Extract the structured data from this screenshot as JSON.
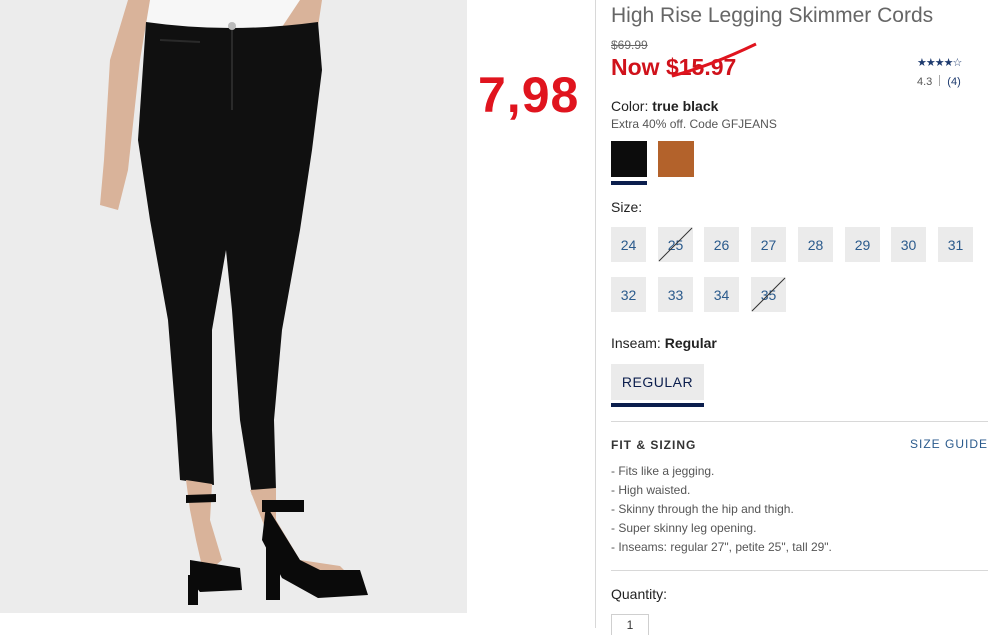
{
  "overlay": {
    "price_text": "7,98"
  },
  "product": {
    "title": "High Rise Legging Skimmer Cords",
    "original_price": "$69.99",
    "now_price": "Now $15.97",
    "rating": {
      "stars": "★★★★☆",
      "score": "4.3",
      "count": "(4)"
    }
  },
  "color": {
    "label": "Color:",
    "value": "true black",
    "promo": "Extra 40% off. Code GFJEANS",
    "swatches": [
      "#0c0c0c",
      "#b3622b"
    ]
  },
  "size": {
    "label": "Size:",
    "options": [
      {
        "label": "24",
        "available": true
      },
      {
        "label": "25",
        "available": false
      },
      {
        "label": "26",
        "available": true
      },
      {
        "label": "27",
        "available": true
      },
      {
        "label": "28",
        "available": true
      },
      {
        "label": "29",
        "available": true
      },
      {
        "label": "30",
        "available": true
      },
      {
        "label": "31",
        "available": true
      },
      {
        "label": "32",
        "available": true
      },
      {
        "label": "33",
        "available": true
      },
      {
        "label": "34",
        "available": true
      },
      {
        "label": "35",
        "available": false
      }
    ]
  },
  "inseam": {
    "label": "Inseam:",
    "value": "Regular",
    "option": "REGULAR"
  },
  "fit": {
    "title": "FIT & SIZING",
    "size_guide": "SIZE GUIDE",
    "items": [
      "- Fits like a jegging.",
      "- High waisted.",
      "- Skinny through the hip and thigh.",
      "- Super skinny leg opening.",
      "- Inseams: regular 27\", petite 25\", tall 29\"."
    ]
  },
  "quantity": {
    "label": "Quantity:",
    "value": "1"
  },
  "colors": {
    "accent_red": "#d0121b",
    "navy": "#0b1e4d",
    "link_blue": "#2a5a8c"
  }
}
